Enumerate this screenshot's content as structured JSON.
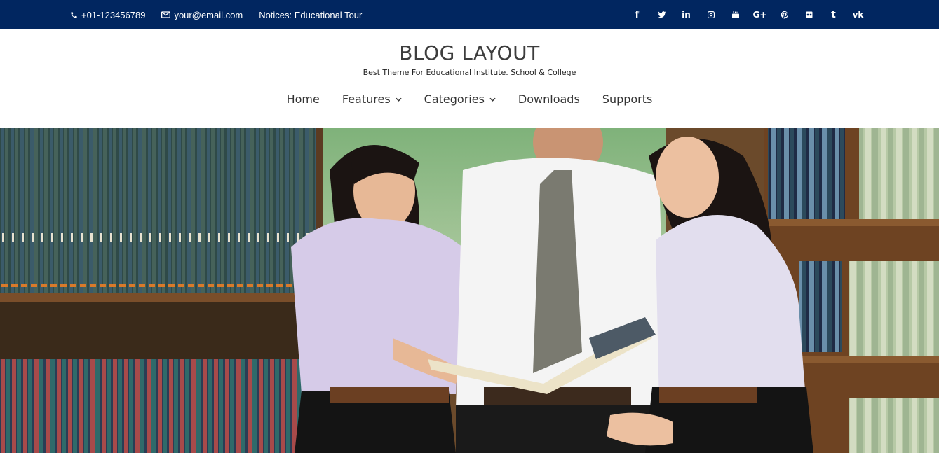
{
  "topbar": {
    "phone": "+01-123456789",
    "email": "your@email.com",
    "notice": "Notices: Educational Tour",
    "social": [
      {
        "icon": "facebook-icon",
        "glyph": "f"
      },
      {
        "icon": "twitter-icon",
        "glyph": ""
      },
      {
        "icon": "linkedin-icon",
        "glyph": "in"
      },
      {
        "icon": "instagram-icon",
        "glyph": ""
      },
      {
        "icon": "youtube-icon",
        "glyph": ""
      },
      {
        "icon": "google-plus-icon",
        "glyph": "G+"
      },
      {
        "icon": "pinterest-icon",
        "glyph": ""
      },
      {
        "icon": "flickr-icon",
        "glyph": ""
      },
      {
        "icon": "tumblr-icon",
        "glyph": "t"
      },
      {
        "icon": "vk-icon",
        "glyph": "vk"
      }
    ]
  },
  "header": {
    "title": "BLOG LAYOUT",
    "tagline": "Best Theme For Educational Institute. School & College"
  },
  "nav": {
    "home": "Home",
    "features": "Features",
    "categories": "Categories",
    "downloads": "Downloads",
    "supports": "Supports"
  },
  "colors": {
    "topbar_bg": "#012660",
    "title": "#3d3d3d"
  }
}
